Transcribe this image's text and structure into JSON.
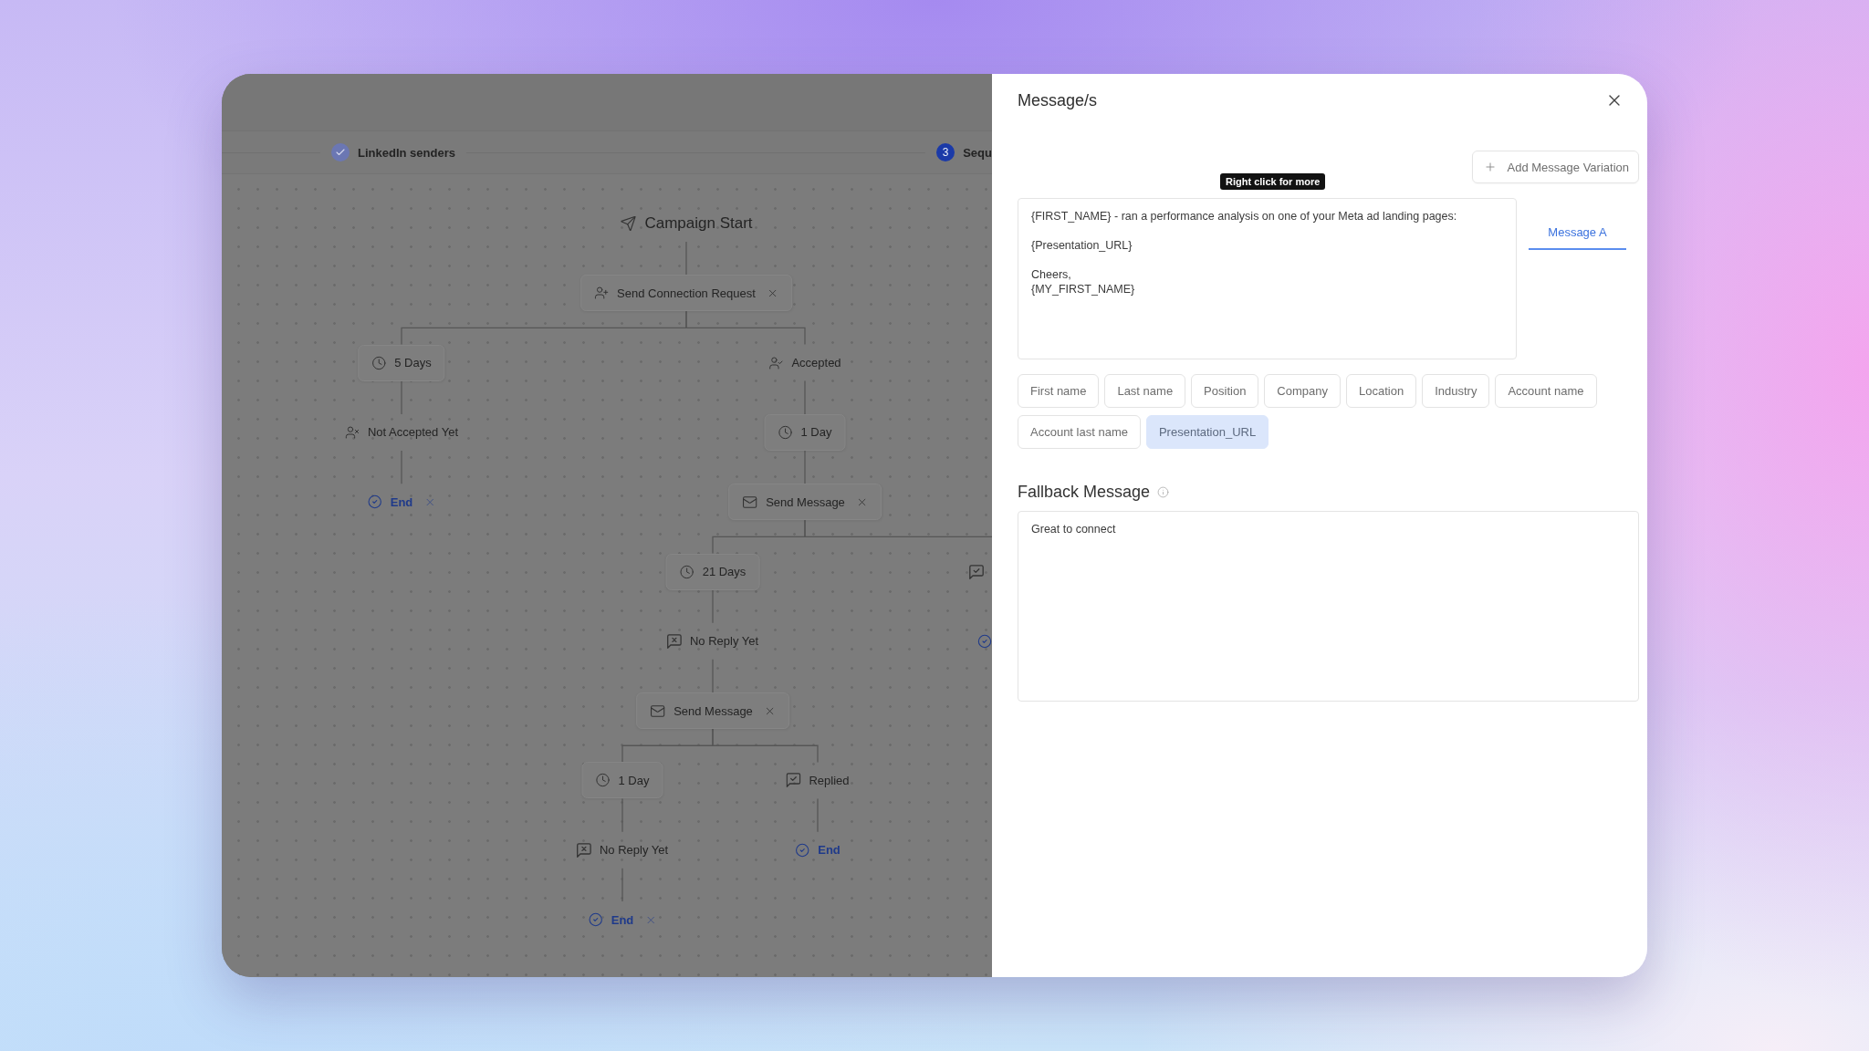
{
  "workflow": {
    "steps": [
      {
        "kind": "done",
        "label": "LinkedIn senders"
      },
      {
        "kind": "current",
        "number": "3",
        "label": "Sequ"
      }
    ],
    "tree": {
      "kind": "start",
      "label": "Campaign Start",
      "children": [
        {
          "kind": "connection_request",
          "label": "Send Connection Request",
          "removable": true,
          "children": [
            {
              "kind": "delay",
              "label": "5 Days",
              "children": [
                {
                  "kind": "not_accepted",
                  "label": "Not Accepted Yet",
                  "children": [
                    {
                      "kind": "end",
                      "label": "End",
                      "removable": true
                    }
                  ]
                }
              ]
            },
            {
              "kind": "accepted",
              "label": "Accepted",
              "children": [
                {
                  "kind": "delay",
                  "label": "1 Day",
                  "children": [
                    {
                      "kind": "message",
                      "label": "Send Message",
                      "removable": true,
                      "children": [
                        {
                          "kind": "delay",
                          "label": "21 Days",
                          "children": [
                            {
                              "kind": "no_reply",
                              "label": "No Reply Yet",
                              "children": [
                                {
                                  "kind": "message",
                                  "label": "Send Message",
                                  "removable": true,
                                  "children": [
                                    {
                                      "kind": "delay",
                                      "label": "1 Day",
                                      "children": [
                                        {
                                          "kind": "no_reply",
                                          "label": "No Reply Yet",
                                          "children": [
                                            {
                                              "kind": "end",
                                              "label": "End",
                                              "removable": true
                                            }
                                          ]
                                        }
                                      ]
                                    },
                                    {
                                      "kind": "replied",
                                      "label": "Replied",
                                      "children": [
                                        {
                                          "kind": "end",
                                          "label": "End",
                                          "removable": false
                                        }
                                      ]
                                    }
                                  ]
                                }
                              ]
                            }
                          ]
                        },
                        {
                          "kind": "replied",
                          "children": [
                            {
                              "kind": "end"
                            }
                          ]
                        }
                      ]
                    }
                  ]
                }
              ]
            }
          ]
        }
      ]
    }
  },
  "drawer": {
    "title": "Message/s",
    "add_button": "Add Message Variation",
    "tooltip": "Right click for more",
    "message": {
      "value": "{FIRST_NAME} - ran a performance analysis on one of your Meta ad landing pages:\n\n{Presentation_URL}\n\nCheers,\n{MY_FIRST_NAME}"
    },
    "message_tabs": [
      {
        "label": "Message A",
        "selected": true
      }
    ],
    "variables": [
      {
        "label": "First name",
        "selected": false
      },
      {
        "label": "Last name",
        "selected": false
      },
      {
        "label": "Position",
        "selected": false
      },
      {
        "label": "Company",
        "selected": false
      },
      {
        "label": "Location",
        "selected": false
      },
      {
        "label": "Industry",
        "selected": false
      },
      {
        "label": "Account name",
        "selected": false
      },
      {
        "label": "Account last name",
        "selected": false
      },
      {
        "label": "Presentation_URL",
        "selected": true
      }
    ],
    "fallback": {
      "title": "Fallback Message",
      "value": "Great to connect"
    }
  }
}
